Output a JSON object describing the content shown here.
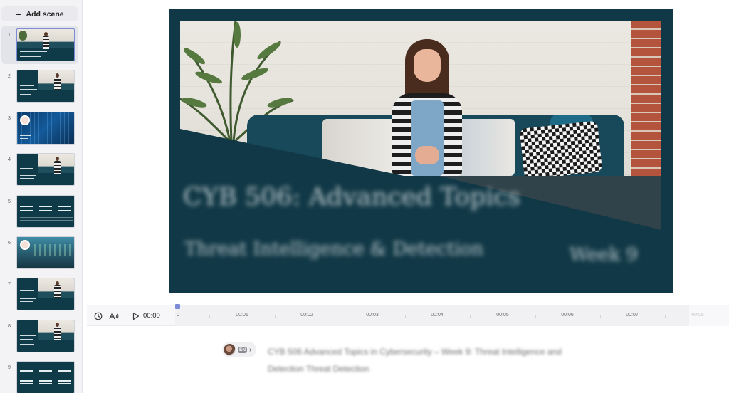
{
  "sidebar": {
    "add_scene_label": "Add scene",
    "scenes": [
      {
        "number": "1",
        "selected": true
      },
      {
        "number": "2"
      },
      {
        "number": "3"
      },
      {
        "number": "4"
      },
      {
        "number": "5"
      },
      {
        "number": "6"
      },
      {
        "number": "7"
      },
      {
        "number": "8"
      },
      {
        "number": "9"
      }
    ]
  },
  "preview": {
    "title": "CYB 506: Advanced Topics",
    "subtitle": "Threat Intelligence & Detection",
    "week": "Week 9",
    "colors": {
      "slide_bg": "#113846",
      "text": "#e8eef0"
    }
  },
  "timeline": {
    "current_time": "00:00",
    "ticks": [
      "0",
      "00:01",
      "00:02",
      "00:03",
      "00:04",
      "00:05",
      "00:06",
      "00:07",
      "00:08"
    ],
    "icons": [
      "clock-icon",
      "voice-speed-icon",
      "play-icon"
    ]
  },
  "script": {
    "language_badge": "EN",
    "text": "CYB 506 Advanced Topics in Cybersecurity – Week 9: Threat Intelligence and Detection Threat Detection"
  }
}
